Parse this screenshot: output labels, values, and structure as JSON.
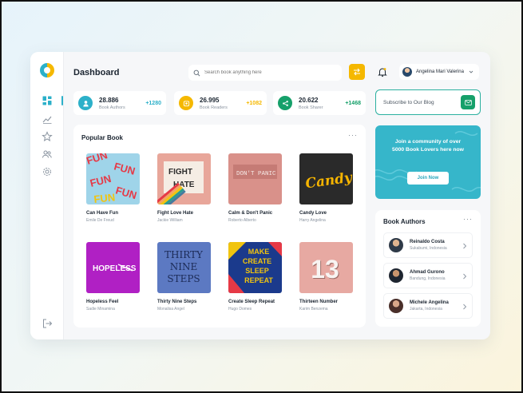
{
  "header": {
    "title": "Dashboard",
    "search_placeholder": "Search book anything here",
    "user_name": "Angelina Mari Valerina"
  },
  "stats": [
    {
      "value": "28.886",
      "label": "Book Authors",
      "delta": "+1280",
      "color": "#2cb0c9",
      "icon": "user-icon"
    },
    {
      "value": "26.995",
      "label": "Book Readers",
      "delta": "+1082",
      "color": "#f5b800",
      "icon": "readers-icon"
    },
    {
      "value": "20.622",
      "label": "Book Sharer",
      "delta": "+1468",
      "color": "#16a06a",
      "icon": "share-icon"
    }
  ],
  "subscribe": {
    "label": "Subscribe to Our Blog",
    "icon": "mail-icon"
  },
  "popular": {
    "title": "Popular Book",
    "books": [
      {
        "title": "Can Have Fun",
        "author": "Emile De Freud",
        "cover_text": "FUN FUN FUN"
      },
      {
        "title": "Fight Love Hate",
        "author": "Jackie William",
        "cover_text": "FIGHT HATE"
      },
      {
        "title": "Calm & Don't Panic",
        "author": "Roberto Alberto",
        "cover_text": "DON'T PANIC"
      },
      {
        "title": "Candy Love",
        "author": "Harry Angelina",
        "cover_text": "Candy"
      },
      {
        "title": "Hopeless Feel",
        "author": "Sadie Minamina",
        "cover_text": "HOPELESS"
      },
      {
        "title": "Thirty Nine Steps",
        "author": "Monalisa Angel",
        "cover_text": "THIRTY NINE STEPS"
      },
      {
        "title": "Create Sleep Repeat",
        "author": "Hugo Domes",
        "cover_text": "MAKE CREATE SLEEP REPEAT"
      },
      {
        "title": "Thirteen Number",
        "author": "Karim Benzema",
        "cover_text": "13"
      }
    ]
  },
  "community": {
    "text": "Join a community of over 5000 Book Lovers here now",
    "button": "Join Now",
    "color": "#36b6ca"
  },
  "authors": {
    "title": "Book Authors",
    "items": [
      {
        "name": "Reinaldo Costa",
        "location": "Sukabumi, Indonesia"
      },
      {
        "name": "Ahmad Gurono",
        "location": "Bandung, Indonesia"
      },
      {
        "name": "Michele Angelina",
        "location": "Jakarta, Indonesia"
      }
    ]
  },
  "colors": {
    "accent": "#2cb0c9",
    "brand_yellow": "#f5b800",
    "green": "#16a06a"
  }
}
